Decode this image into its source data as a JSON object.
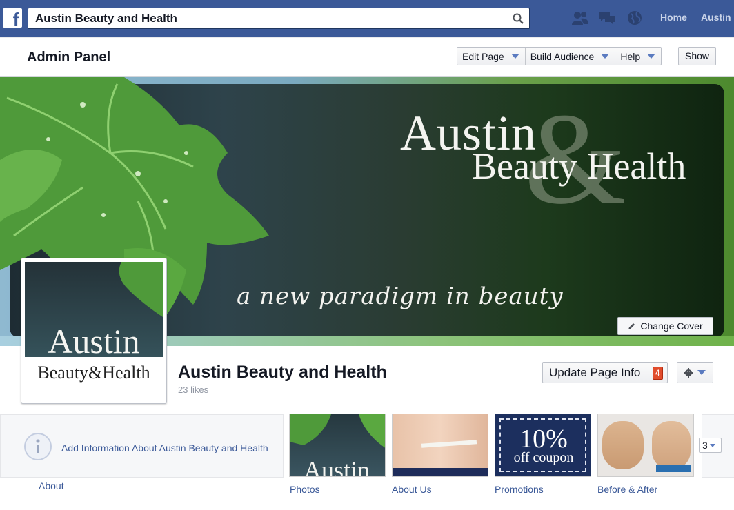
{
  "topbar": {
    "search_value": "Austin Beauty and Health",
    "nav_home": "Home",
    "nav_profile": "Austin",
    "logo_letter": "f"
  },
  "admin": {
    "title": "Admin Panel",
    "edit_page": "Edit Page",
    "build_audience": "Build Audience",
    "help": "Help",
    "show": "Show"
  },
  "cover": {
    "title_line1": "Austin",
    "ampersand": "&",
    "title_line2": "Beauty Health",
    "tagline": "a new paradigm in beauty",
    "change_cover": "Change Cover"
  },
  "profile": {
    "pic_title": "Austin",
    "pic_subtitle": "Beauty&Health",
    "page_name": "Austin Beauty and Health",
    "likes": "23 likes",
    "update_info": "Update Page Info",
    "update_badge": "4"
  },
  "apps": {
    "about_prompt": "Add Information About Austin Beauty and Health",
    "about_label": "About",
    "photos_label": "Photos",
    "photos_thumb_text": "Austin",
    "aboutus_label": "About Us",
    "promotions_label": "Promotions",
    "promo_big": "10%",
    "promo_small": "off coupon",
    "before_after_label": "Before & After",
    "more_count": "3"
  },
  "colors": {
    "facebook_blue": "#3b5998",
    "link_blue": "#3b5998",
    "badge_red": "#e14c2c"
  }
}
